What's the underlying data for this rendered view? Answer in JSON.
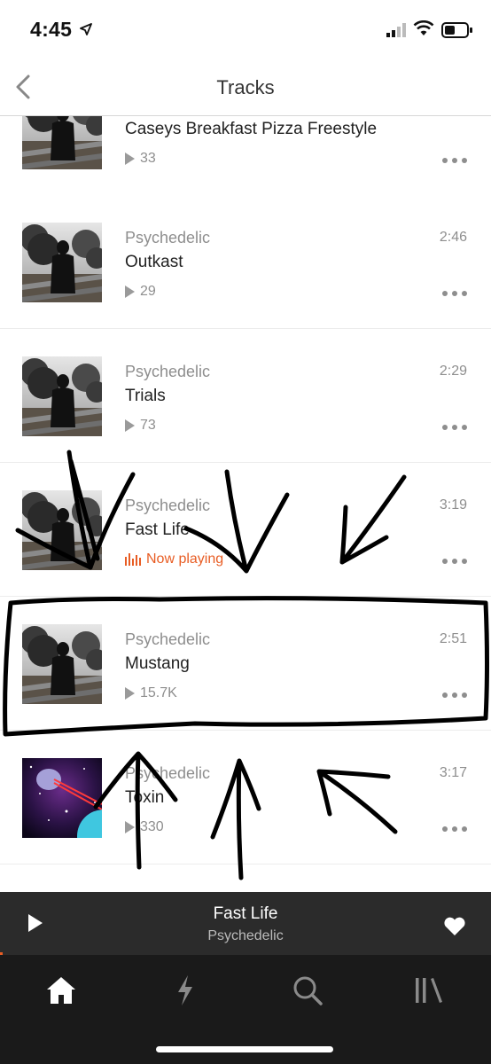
{
  "status_bar": {
    "time": "4:45"
  },
  "header": {
    "title": "Tracks"
  },
  "tracks": [
    {
      "album": "",
      "title": "Caseys Breakfast Pizza Freestyle",
      "duration": "",
      "plays": "33",
      "art": "photo"
    },
    {
      "album": "Psychedelic",
      "title": "Outkast",
      "duration": "2:46",
      "plays": "29",
      "art": "photo"
    },
    {
      "album": "Psychedelic",
      "title": "Trials",
      "duration": "2:29",
      "plays": "73",
      "art": "photo"
    },
    {
      "album": "Psychedelic",
      "title": "Fast Life",
      "duration": "3:19",
      "status": "Now playing",
      "art": "photo"
    },
    {
      "album": "Psychedelic",
      "title": "Mustang",
      "duration": "2:51",
      "plays": "15.7K",
      "art": "photo"
    },
    {
      "album": "Psychedelic",
      "title": "Toxin",
      "duration": "3:17",
      "plays": "330",
      "art": "space"
    }
  ],
  "mini_player": {
    "title": "Fast Life",
    "artist": "Psychedelic"
  },
  "tab_bar": {
    "items": [
      "home-icon",
      "stream-icon",
      "search-icon",
      "library-icon"
    ],
    "active": "home-icon"
  },
  "colors": {
    "accent": "#e85d24",
    "tab_bar_bg": "#1a1a1a",
    "mini_player_bg": "#2b2b2b"
  }
}
